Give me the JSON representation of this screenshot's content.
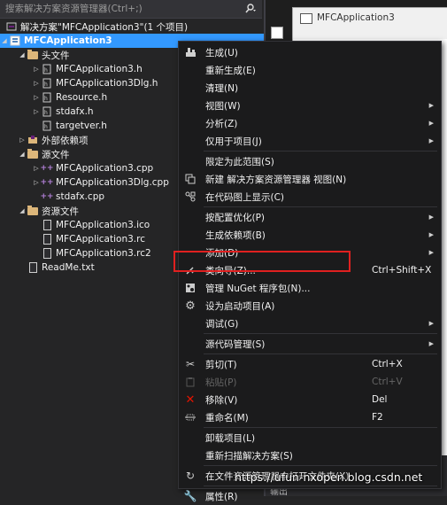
{
  "search": {
    "placeholder": "搜索解决方案资源管理器(Ctrl+;)",
    "icon": "search-icon"
  },
  "tree": [
    {
      "label": "解决方案\"MFCApplication3\"(1 个项目)",
      "kind": "solution"
    },
    {
      "label": "MFCApplication3",
      "kind": "project",
      "selected": true
    },
    {
      "label": "头文件",
      "kind": "folder"
    },
    {
      "label": "MFCApplication3.h",
      "kind": "header"
    },
    {
      "label": "MFCApplication3Dlg.h",
      "kind": "header"
    },
    {
      "label": "Resource.h",
      "kind": "header"
    },
    {
      "label": "stdafx.h",
      "kind": "header"
    },
    {
      "label": "targetver.h",
      "kind": "header"
    },
    {
      "label": "外部依赖项",
      "kind": "deps"
    },
    {
      "label": "源文件",
      "kind": "folder"
    },
    {
      "label": "MFCApplication3.cpp",
      "kind": "cpp"
    },
    {
      "label": "MFCApplication3Dlg.cpp",
      "kind": "cpp"
    },
    {
      "label": "stdafx.cpp",
      "kind": "cpp"
    },
    {
      "label": "资源文件",
      "kind": "folder"
    },
    {
      "label": "MFCApplication3.ico",
      "kind": "resource"
    },
    {
      "label": "MFCApplication3.rc",
      "kind": "resource"
    },
    {
      "label": "MFCApplication3.rc2",
      "kind": "resource"
    },
    {
      "label": "ReadMe.txt",
      "kind": "text"
    }
  ],
  "background": {
    "window_title": "MFCApplication3",
    "bottom_tab": "输出"
  },
  "menu": [
    {
      "label": "生成(U)",
      "icon": "build-icon"
    },
    {
      "label": "重新生成(E)"
    },
    {
      "label": "清理(N)"
    },
    {
      "label": "视图(W)",
      "submenu": true
    },
    {
      "label": "分析(Z)",
      "submenu": true
    },
    {
      "label": "仅用于项目(J)",
      "submenu": true
    },
    {
      "sep": true
    },
    {
      "label": "限定为此范围(S)"
    },
    {
      "label": "新建 解决方案资源管理器 视图(N)",
      "icon": "new-view-icon"
    },
    {
      "label": "在代码图上显示(C)",
      "icon": "code-map-icon"
    },
    {
      "sep": true
    },
    {
      "label": "按配置优化(P)",
      "submenu": true
    },
    {
      "label": "生成依赖项(B)",
      "submenu": true
    },
    {
      "label": "添加(D)",
      "submenu": true
    },
    {
      "label": "类向导(Z)...",
      "shortcut": "Ctrl+Shift+X",
      "icon": "class-wizard-icon",
      "highlighted": true
    },
    {
      "label": "管理 NuGet 程序包(N)...",
      "icon": "nuget-icon"
    },
    {
      "label": "设为启动项目(A)",
      "icon": "startup-gear-icon"
    },
    {
      "label": "调试(G)",
      "submenu": true
    },
    {
      "sep": true
    },
    {
      "label": "源代码管理(S)",
      "submenu": true
    },
    {
      "sep": true
    },
    {
      "label": "剪切(T)",
      "shortcut": "Ctrl+X",
      "icon": "cut-icon"
    },
    {
      "label": "粘贴(P)",
      "shortcut": "Ctrl+V",
      "icon": "paste-icon",
      "disabled": true
    },
    {
      "label": "移除(V)",
      "shortcut": "Del",
      "icon": "remove-icon"
    },
    {
      "label": "重命名(M)",
      "shortcut": "F2",
      "icon": "rename-icon"
    },
    {
      "sep": true
    },
    {
      "label": "卸载项目(L)"
    },
    {
      "label": "重新扫描解决方案(S)"
    },
    {
      "sep": true
    },
    {
      "label": "在文件资源管理器中打开文件夹(X)",
      "icon": "open-folder-icon"
    },
    {
      "sep": true
    },
    {
      "label": "属性(R)",
      "icon": "properties-icon"
    }
  ],
  "colors": {
    "selection": "#3399ff",
    "highlight_box": "#e02020",
    "menu_bg": "#1b1b1c"
  },
  "watermark": "https://ufun-nxopen.blog.csdn.net"
}
